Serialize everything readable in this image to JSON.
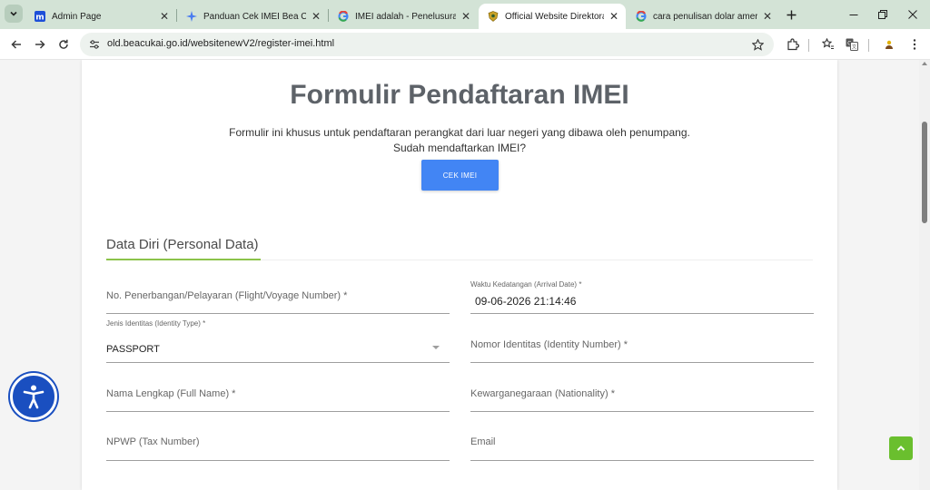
{
  "browser": {
    "tabs": [
      {
        "title": "Admin Page",
        "favicon": "m-logo-icon",
        "active": false
      },
      {
        "title": "Panduan Cek IMEI Bea Cukai",
        "favicon": "sparkle-icon",
        "active": false
      },
      {
        "title": "IMEI adalah - Penelusuran G",
        "favicon": "google-icon",
        "active": false
      },
      {
        "title": "Official Website Direktorat Je",
        "favicon": "customs-emblem-icon",
        "active": true
      },
      {
        "title": "cara penulisan dolar amerika",
        "favicon": "google-icon",
        "active": false
      }
    ],
    "url": "old.beacukai.go.id/websitenewV2/register-imei.html",
    "colors": {
      "tabstrip": "#d3e3d6",
      "omnibox": "#edf2ee"
    }
  },
  "page": {
    "title": "Formulir Pendaftaran IMEI",
    "description_line1": "Formulir ini khusus untuk pendaftaran perangkat dari luar negeri yang dibawa oleh penumpang.",
    "description_line2": "Sudah mendaftarkan IMEI?",
    "cek_button": "CEK IMEI",
    "section_title": "Data Diri (Personal Data)",
    "fields": {
      "flight_number": {
        "label": "No. Penerbangan/Pelayaran (Flight/Voyage Number) *"
      },
      "arrival_date": {
        "label": "Waktu Kedatangan (Arrival Date) *",
        "value": "09-06-2026  21:14:46"
      },
      "identity_type": {
        "label": "Jenis Identitas (Identity Type) *",
        "value": "PASSPORT"
      },
      "identity_number": {
        "label": "Nomor Identitas (Identity Number) *"
      },
      "full_name": {
        "label": "Nama Lengkap (Full Name) *"
      },
      "nationality": {
        "label": "Kewarganegaraan (Nationality) *"
      },
      "npwp": {
        "label": "NPWP (Tax Number)"
      },
      "email": {
        "label": "Email"
      }
    },
    "colors": {
      "accent_button": "#4285f4",
      "section_underline": "#8bc34a",
      "back_to_top": "#6abf2e",
      "accessibility": "#1a4fc0"
    }
  }
}
